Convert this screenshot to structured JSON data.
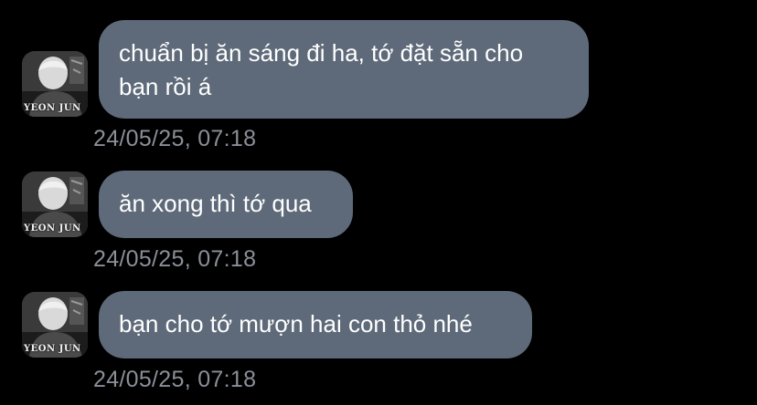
{
  "colors": {
    "background": "#000000",
    "bubble": "#5e6a79",
    "bubble_text": "#ffffff",
    "timestamp": "#8a8f98"
  },
  "messages": [
    {
      "avatar_icon": "profile-photo-icon",
      "avatar_caption": "YEON JUN",
      "text": "chuẩn bị ăn sáng đi ha, tớ đặt sẵn cho bạn rồi á",
      "timestamp": "24/05/25, 07:18"
    },
    {
      "avatar_icon": "profile-photo-icon",
      "avatar_caption": "YEON JUN",
      "text": "ăn xong thì tớ qua",
      "timestamp": "24/05/25, 07:18"
    },
    {
      "avatar_icon": "profile-photo-icon",
      "avatar_caption": "YEON JUN",
      "text": "bạn cho tớ mượn hai con thỏ nhé",
      "timestamp": "24/05/25, 07:18"
    }
  ]
}
